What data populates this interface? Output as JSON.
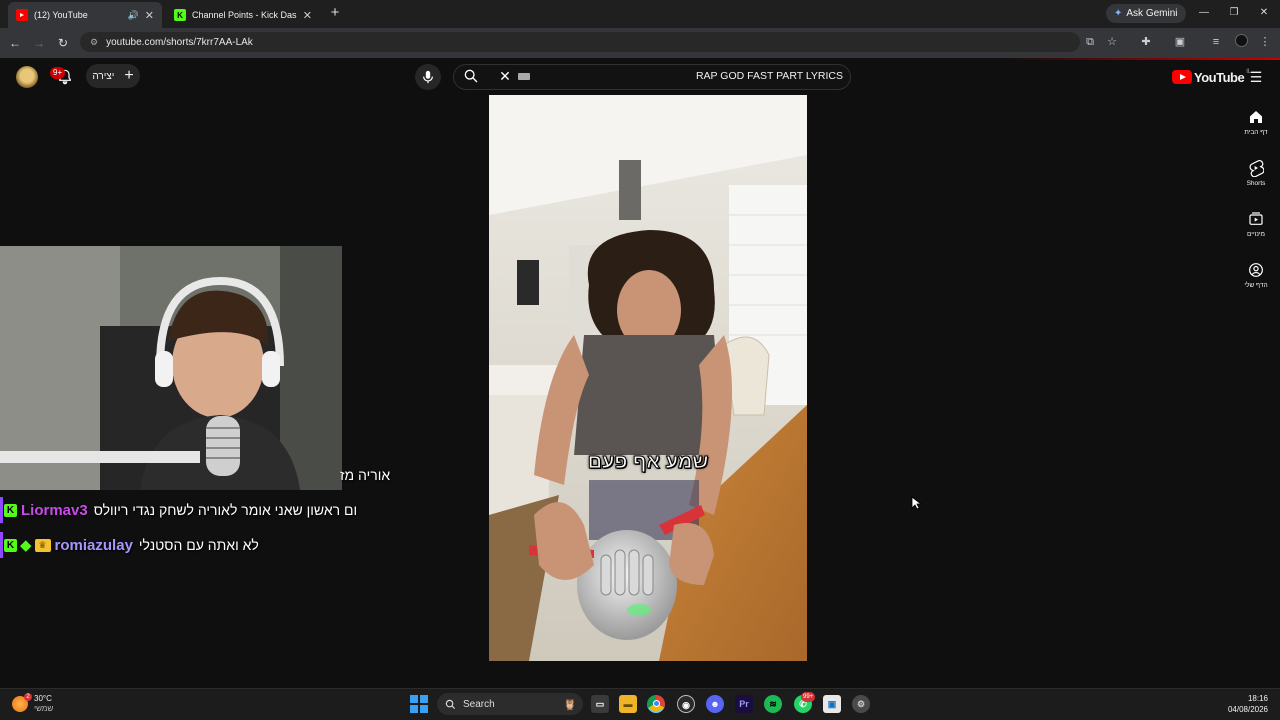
{
  "browser": {
    "tabs": [
      {
        "title": "(12) YouTube",
        "active": true,
        "audio": true
      },
      {
        "title": "Channel Points - Kick Dashboard",
        "active": false,
        "audio": false
      }
    ],
    "gemini_label": "Ask Gemini",
    "url": "youtube.com/shorts/7krr7AA-LAk"
  },
  "youtube": {
    "notification_count": "9+",
    "create_label": "יצירה",
    "search_query": "RAP GOD FAST PART LYRICS",
    "logo_text": "YouTube",
    "logo_country": "IL",
    "guide": [
      {
        "label": "דף הבית",
        "icon": "home-icon"
      },
      {
        "label": "Shorts",
        "icon": "shorts-icon"
      },
      {
        "label": "מינויים",
        "icon": "subscriptions-icon"
      },
      {
        "label": "הדף שלי",
        "icon": "you-icon"
      }
    ],
    "short_caption": "שמע אף פעם"
  },
  "chat": {
    "partial_line": "אוריה מז",
    "lines": [
      {
        "user": "Liormav3",
        "user_color": "#c94be9",
        "message": "ום ראשון שאני אומר לאוריה לשחק נגדי ריוולס",
        "badges": [
          "kick"
        ]
      },
      {
        "user": "romiazulay",
        "user_color": "#a993ff",
        "message": "לא ואתה עם הסטנלי",
        "badges": [
          "kick",
          "diamond",
          "crown"
        ]
      }
    ]
  },
  "taskbar": {
    "weather_temp": "30°C",
    "weather_desc": "שמשי",
    "search_label": "Search",
    "time": "18:16",
    "date": "04/08/2026",
    "whatsapp_badge": "99+"
  },
  "colors": {
    "yt_red": "#ff0000",
    "kick_green": "#53fc18",
    "accent_blue": "#3aa0f3"
  }
}
